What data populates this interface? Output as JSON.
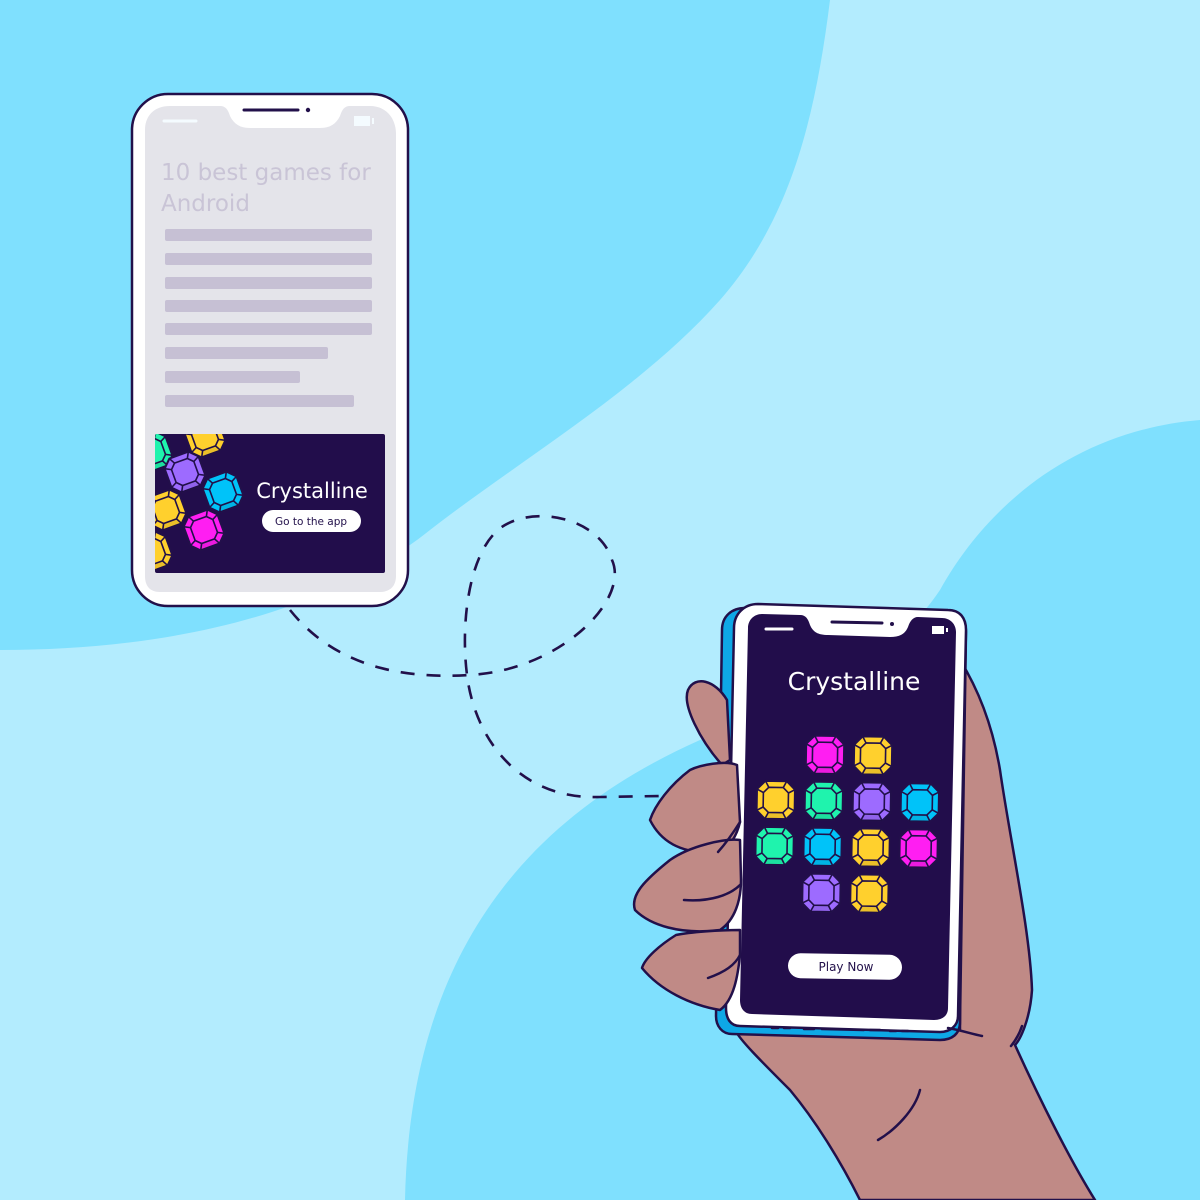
{
  "colors": {
    "bg_light": "#b3ecfe",
    "bg_dark": "#7fe0fe",
    "outline": "#22104a",
    "screen_gray": "#e4e4ea",
    "line_gray": "#c6c0d4",
    "title_gray": "#c9c4d6",
    "ad_bg": "#220d4b",
    "phone_blue": "#0ea8e6",
    "skin": "#c08a86",
    "white": "#ffffff"
  },
  "article_phone": {
    "headline_line1": "10 best games for",
    "headline_line2": "Android",
    "text_line_count": 8,
    "ad": {
      "title": "Crystalline",
      "button_label": "Go to the app"
    }
  },
  "game_phone": {
    "title": "Crystalline",
    "play_button_label": "Play Now",
    "gem_grid": [
      [
        "empty",
        "magenta",
        "yellow",
        "empty"
      ],
      [
        "yellow",
        "green",
        "purple",
        "blue"
      ],
      [
        "green",
        "blue",
        "yellow",
        "magenta"
      ],
      [
        "empty",
        "purple",
        "yellow",
        "empty"
      ]
    ]
  },
  "gem_colors": {
    "magenta": "#ff1ef2",
    "yellow": "#ffd02d",
    "green": "#1ff3ad",
    "purple": "#9d6bff",
    "blue": "#00c3f9"
  },
  "ad_gems": [
    "green",
    "yellow",
    "purple",
    "blue",
    "yellow",
    "magenta",
    "yellow"
  ]
}
